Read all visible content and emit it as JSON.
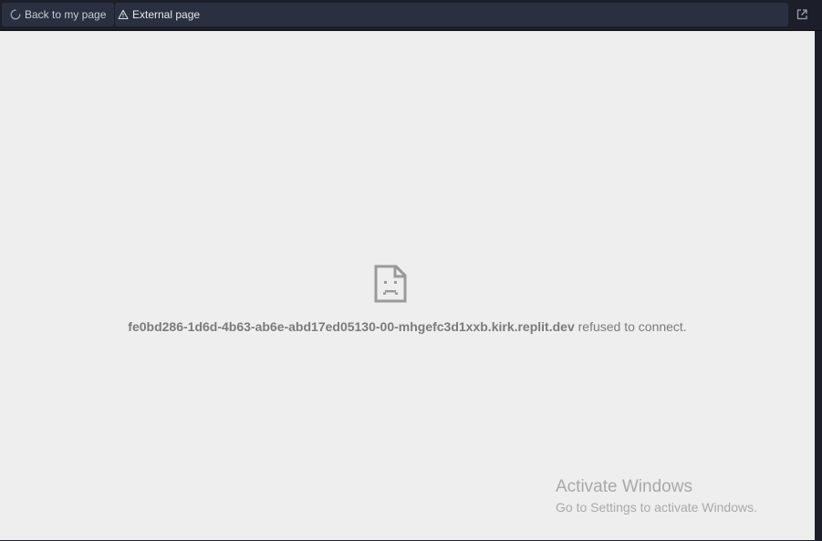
{
  "toolbar": {
    "back_label": "Back to my page",
    "back_icon": "loading-spinner-icon",
    "url_label": "External page",
    "url_icon": "warning-triangle-icon",
    "open_external_icon": "open-external-icon"
  },
  "error": {
    "icon": "sad-document-icon",
    "host": "fe0bd286-1d6d-4b63-ab6e-abd17ed05130-00-mhgefc3d1xxb.kirk.replit.dev",
    "message": "refused to connect."
  },
  "watermark": {
    "title": "Activate Windows",
    "subtitle": "Go to Settings to activate Windows."
  },
  "colors": {
    "toolbar_bg": "#1c1f2a",
    "button_bg": "#2b3041",
    "content_bg": "#eeeeee",
    "error_text": "#7b7b7b"
  }
}
